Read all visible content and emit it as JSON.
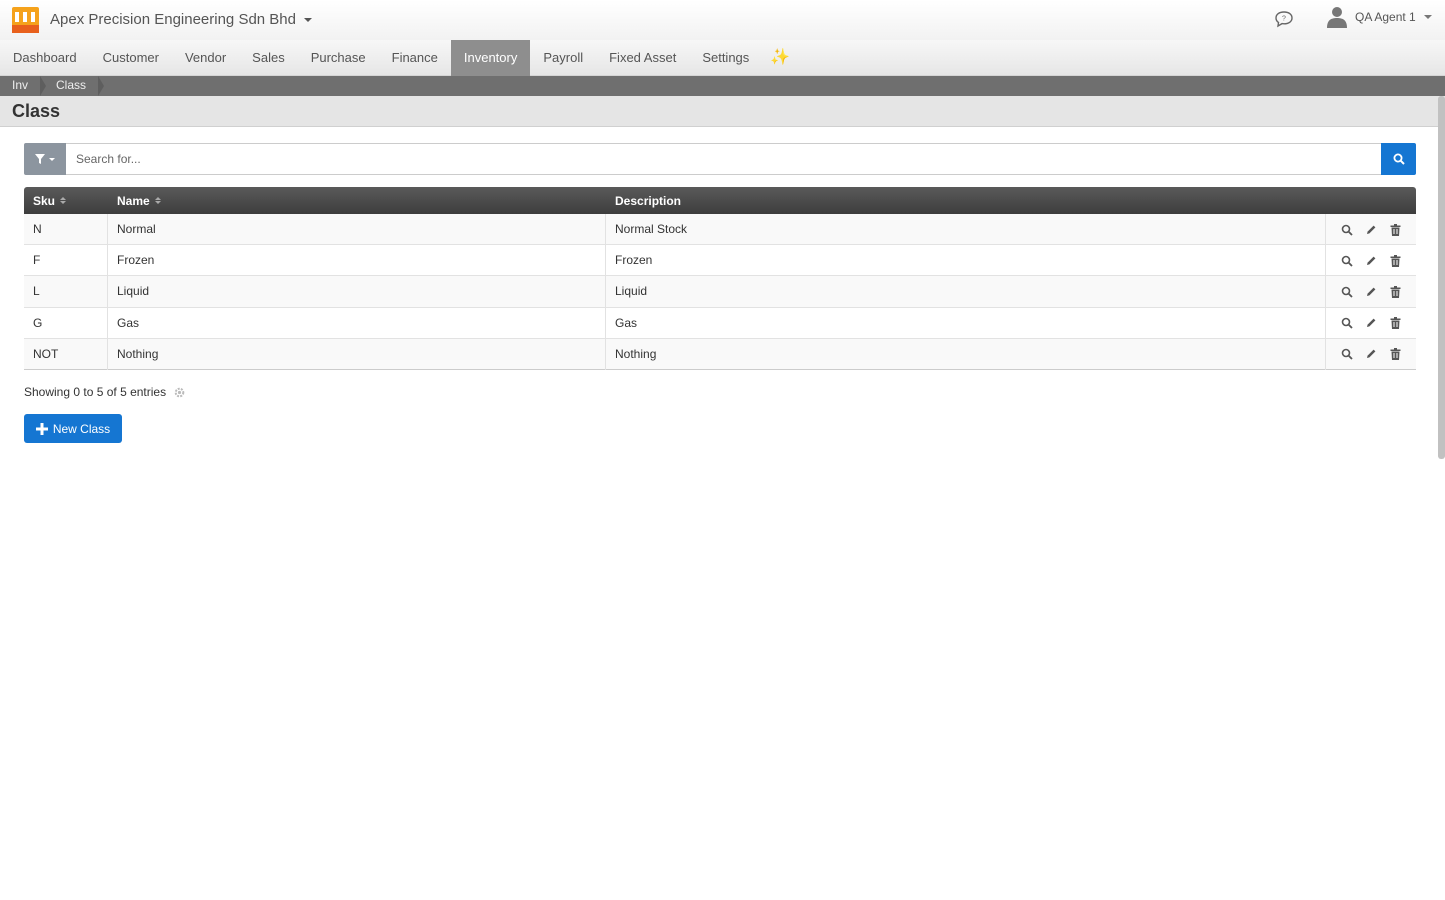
{
  "header": {
    "company": "Apex Precision Engineering Sdn Bhd",
    "user": "QA Agent 1"
  },
  "nav": {
    "items": [
      "Dashboard",
      "Customer",
      "Vendor",
      "Sales",
      "Purchase",
      "Finance",
      "Inventory",
      "Payroll",
      "Fixed Asset",
      "Settings"
    ],
    "active": "Inventory",
    "sparkle": "✨"
  },
  "breadcrumb": [
    "Inv",
    "Class"
  ],
  "page": {
    "title": "Class"
  },
  "search": {
    "placeholder": "Search for..."
  },
  "table": {
    "headers": {
      "sku": "Sku",
      "name": "Name",
      "description": "Description"
    },
    "rows": [
      {
        "sku": "N",
        "name": "Normal",
        "description": "Normal Stock"
      },
      {
        "sku": "F",
        "name": "Frozen",
        "description": "Frozen"
      },
      {
        "sku": "L",
        "name": "Liquid",
        "description": "Liquid"
      },
      {
        "sku": "G",
        "name": "Gas",
        "description": "Gas"
      },
      {
        "sku": "NOT",
        "name": "Nothing",
        "description": "Nothing"
      }
    ]
  },
  "footer": {
    "showing": "Showing 0 to 5 of 5 entries",
    "new_button": "New Class"
  },
  "colors": {
    "primary": "#1576d2",
    "nav_active": "#8e8e8e",
    "breadcrumb": "#6f6f6f",
    "table_header": "#4a4a4a",
    "logo_orange": "#f5a21b"
  }
}
